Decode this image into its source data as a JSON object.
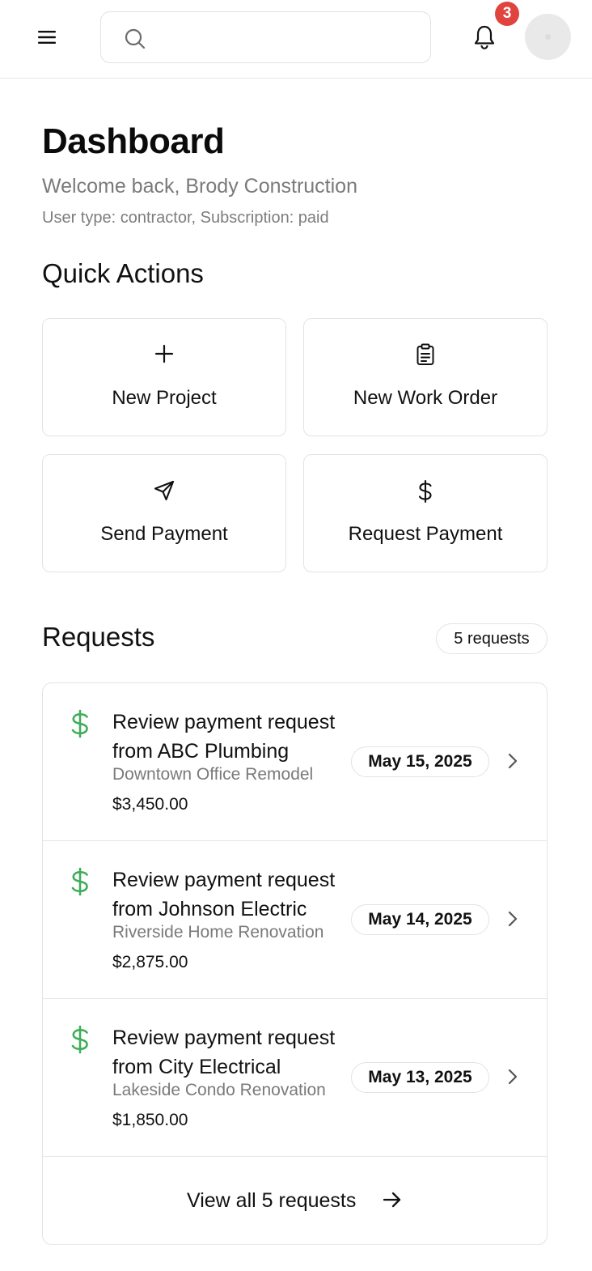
{
  "header": {
    "search_placeholder": "",
    "notification_count": "3"
  },
  "page": {
    "title": "Dashboard",
    "welcome": "Welcome back, Brody Construction",
    "user_info": "User type: contractor, Subscription: paid"
  },
  "quick_actions": {
    "title": "Quick Actions",
    "items": [
      {
        "label": "New Project",
        "icon": "plus-icon"
      },
      {
        "label": "New Work Order",
        "icon": "clipboard-icon"
      },
      {
        "label": "Send Payment",
        "icon": "send-icon"
      },
      {
        "label": "Request Payment",
        "icon": "dollar-icon"
      }
    ]
  },
  "requests": {
    "title": "Requests",
    "count_label": "5 requests",
    "items": [
      {
        "title": "Review payment request from ABC Plumbing",
        "project": "Downtown Office Remodel",
        "amount": "$3,450.00",
        "date": "May 15, 2025"
      },
      {
        "title": "Review payment request from Johnson Electric",
        "project": "Riverside Home Renovation",
        "amount": "$2,875.00",
        "date": "May 14, 2025"
      },
      {
        "title": "Review payment request from City Electrical",
        "project": "Lakeside Condo Renovation",
        "amount": "$1,850.00",
        "date": "May 13, 2025"
      }
    ],
    "view_all_label": "View all 5 requests"
  },
  "colors": {
    "accent_green": "#3fae5a",
    "badge_red": "#e0443e",
    "muted_text": "#7a7a7a",
    "border": "#e3e3e3"
  }
}
